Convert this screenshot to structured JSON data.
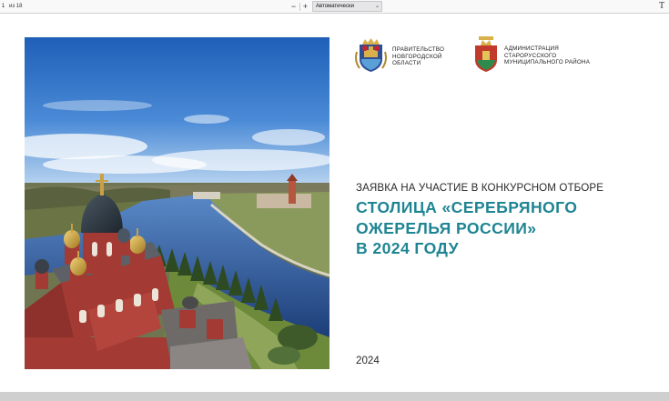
{
  "toolbar": {
    "page_number": "1",
    "page_of": "из 18",
    "zoom_out_label": "−",
    "zoom_in_label": "+",
    "zoom_value": "Автоматически",
    "text_tool_label": "T"
  },
  "document": {
    "logo_left": {
      "emblem": "novgorod-oblast-coat-of-arms-icon",
      "lines": [
        "ПРАВИТЕЛЬСТВО",
        "НОВГОРОДСКОЙ",
        "ОБЛАСТИ"
      ]
    },
    "logo_right": {
      "emblem": "staraya-russa-coat-of-arms-icon",
      "lines": [
        "АДМИНИСТРАЦИЯ",
        "СТАРОРУССКОГО",
        "МУНИЦИПАЛЬНОГО РАЙОНА"
      ]
    },
    "subtitle": "ЗАЯВКА НА УЧАСТИЕ В КОНКУРСНОМ ОТБОРЕ",
    "title_lines": [
      "СТОЛИЦА «СЕРЕБРЯНОГО",
      "ОЖЕРЕЛЬЯ РОССИИ»",
      "В 2024 ГОДУ"
    ],
    "year": "2024",
    "photo": "aerial-photo-church-and-river"
  },
  "colors": {
    "title_accent": "#1f8593",
    "sky": "#3a7fd0",
    "church_red": "#a33a33"
  }
}
